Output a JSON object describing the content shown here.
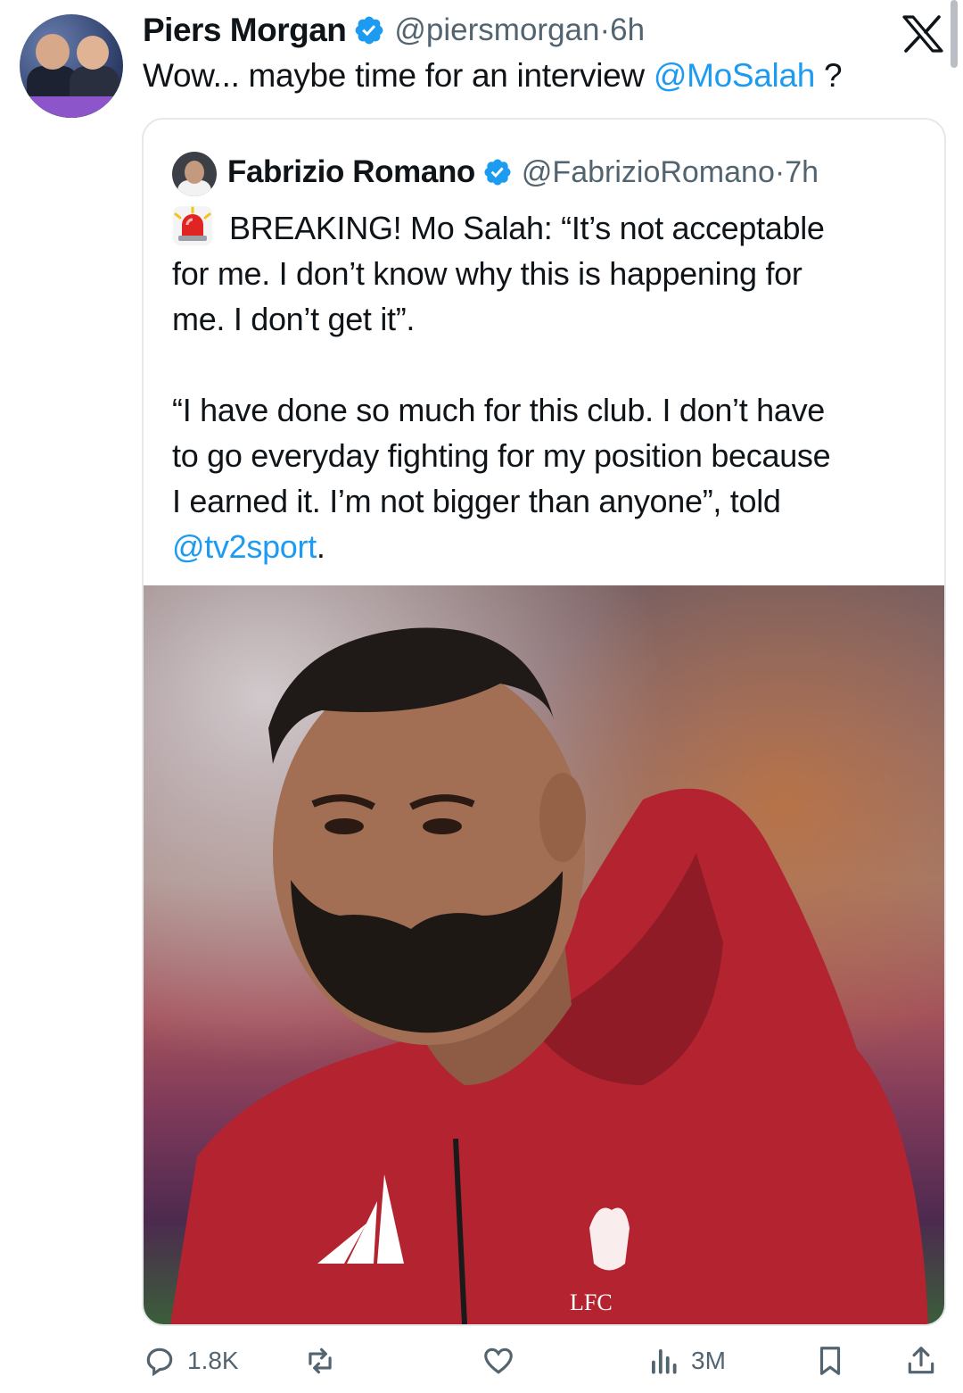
{
  "tweet": {
    "author_name": "Piers Morgan",
    "author_handle": "@piersmorgan",
    "separator": " · ",
    "time": "6h",
    "text_prefix": "Wow... maybe time for an interview ",
    "mention": "@MoSalah",
    "text_suffix": " ?"
  },
  "quote": {
    "author_name": "Fabrizio Romano",
    "author_handle": "@FabrizioRomano",
    "separator": " · ",
    "time": "7h",
    "line1": "BREAKING! Mo Salah: “It’s not acceptable",
    "line2": "for me. I don’t know why this is happening for",
    "line3": "me. I don’t get it”.",
    "line4": "“I have done so much for this club. I don’t have",
    "line5": "to go everyday fighting for my position because",
    "line6": "I earned it. I’m not bigger than anyone”, told",
    "mention": "@tv2sport",
    "mention_suffix": ".",
    "photo_crest_text": "LFC"
  },
  "actions": {
    "replies": "1.8K",
    "views": "3M"
  },
  "colors": {
    "link": "#1d9bf0",
    "secondary": "#536471",
    "verified": "#1d9bf0"
  },
  "icons": [
    "verified-badge-icon",
    "x-logo-icon",
    "siren-icon",
    "reply-icon",
    "repost-icon",
    "like-icon",
    "views-icon",
    "bookmark-icon",
    "share-icon"
  ]
}
